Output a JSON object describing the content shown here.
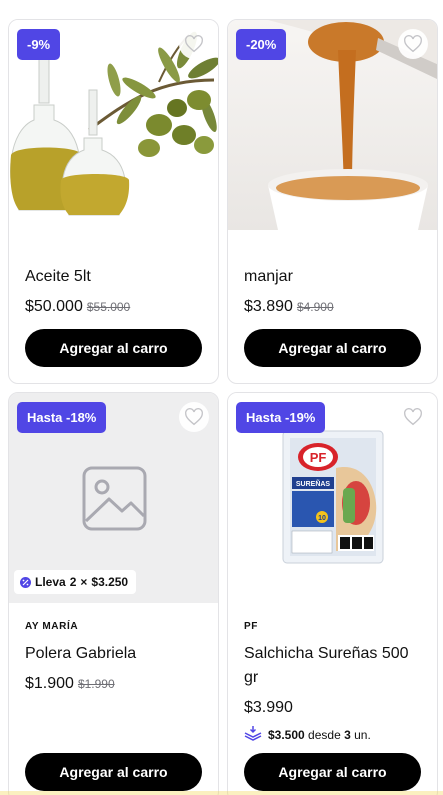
{
  "products": [
    {
      "badge": "-9%",
      "title": "Aceite 5lt",
      "price": "$50.000",
      "old_price": "$55.000",
      "button": "Agregar al carro",
      "image": "olive-oil-bottles-image"
    },
    {
      "badge": "-20%",
      "title": "manjar",
      "price": "$3.890",
      "old_price": "$4.900",
      "button": "Agregar al carro",
      "image": "caramel-spoon-image"
    },
    {
      "badge": "Hasta -18%",
      "brand": "AY MARÍA",
      "title": "Polera Gabriela",
      "price": "$1.900",
      "old_price": "$1.990",
      "button": "Agregar al carro",
      "image": "placeholder-image-icon",
      "promo": {
        "prefix": "Lleva",
        "qty": "2",
        "times": "×",
        "amount": "$3.250"
      }
    },
    {
      "badge": "Hasta -19%",
      "brand": "PF",
      "title": "Salchicha Sureñas 500 gr",
      "price": "$3.990",
      "button": "Agregar al carro",
      "image": "sausage-package-image",
      "package": {
        "logo": "PF",
        "name": "SUREÑAS",
        "count": "10"
      },
      "tier": {
        "amount": "$3.500",
        "middle": "desde",
        "qty": "3",
        "unit": "un."
      }
    }
  ],
  "colors": {
    "accent": "#5046e5",
    "button": "#000000",
    "border": "#e3e3e6"
  }
}
